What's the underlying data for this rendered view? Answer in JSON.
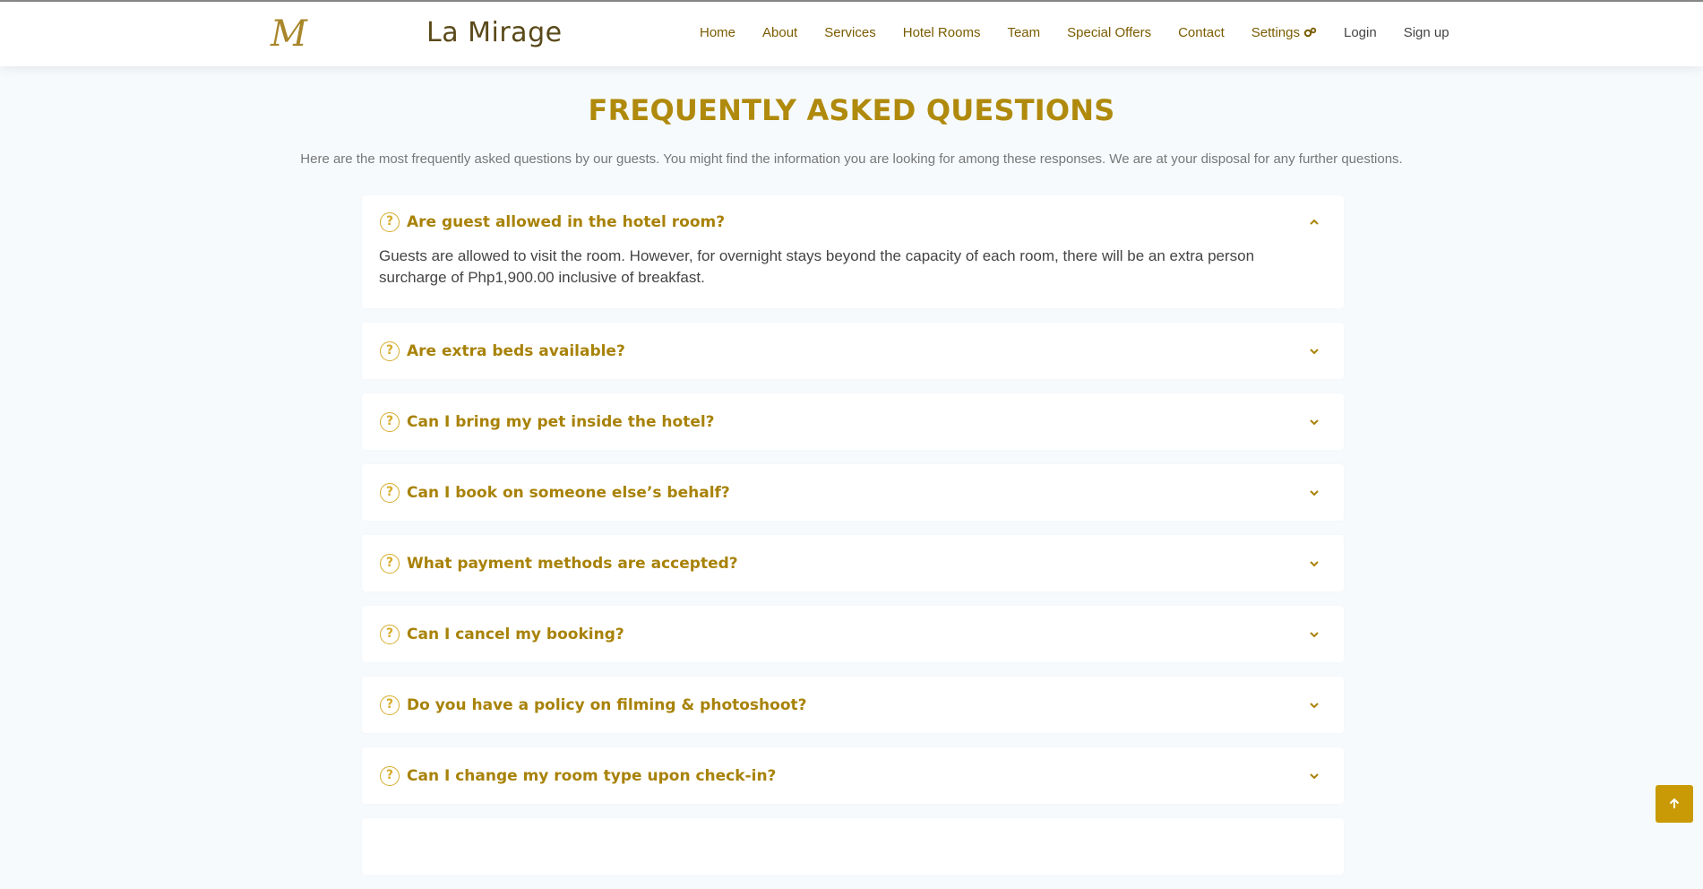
{
  "header": {
    "logo_letter": "M",
    "brand": "La Mirage",
    "nav": [
      {
        "label": "Home"
      },
      {
        "label": "About"
      },
      {
        "label": "Services"
      },
      {
        "label": "Hotel Rooms"
      },
      {
        "label": "Team"
      },
      {
        "label": "Special Offers"
      },
      {
        "label": "Contact"
      },
      {
        "label": "Settings"
      }
    ],
    "login": "Login",
    "signup": "Sign up",
    "settings_icon": "gears-icon"
  },
  "faq": {
    "title": "FREQUENTLY ASKED QUESTIONS",
    "subtitle": "Here are the most frequently asked questions by our guests. You might find the information you are looking for among these responses. We are at your disposal for any further questions.",
    "items": [
      {
        "question": "Are guest allowed in the hotel room?",
        "answer": "Guests are allowed to visit the room. However, for overnight stays beyond the capacity of each room, there will be an extra person surcharge of Php1,900.00 inclusive of breakfast.",
        "expanded": true
      },
      {
        "question": "Are extra beds available?",
        "expanded": false
      },
      {
        "question": "Can I bring my pet inside the hotel?",
        "expanded": false
      },
      {
        "question": "Can I book on someone else’s behalf?",
        "expanded": false
      },
      {
        "question": "What payment methods are accepted?",
        "expanded": false
      },
      {
        "question": "Can I cancel my booking?",
        "expanded": false
      },
      {
        "question": "Do you have a policy on filming & photoshoot?",
        "expanded": false
      },
      {
        "question": "Can I change my room type upon check-in?",
        "expanded": false
      }
    ]
  },
  "colors": {
    "accent": "#b08a0c",
    "button": "#c99a06",
    "background": "#f6fafd"
  }
}
